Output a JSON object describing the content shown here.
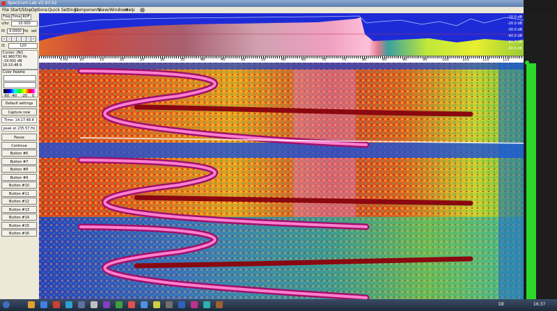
{
  "window": {
    "title": "Spectrum Lab V2.93 b2"
  },
  "menu": [
    "File",
    "Start/Stop",
    "Options",
    "Quick Settings",
    "Components",
    "View/Windows",
    "Help"
  ],
  "tabs": [
    "Freq",
    "Time",
    "RDF"
  ],
  "controls": {
    "vertical_label": "v/hz",
    "freq_value": "10 000",
    "offset_label": "f0",
    "offset_value": "0.0000",
    "offset_unit": "Hz",
    "offset_button": "set",
    "zoom_label": "f2",
    "zoom_value": "120"
  },
  "cursor": {
    "header": "Cursor: [Ni]",
    "freq": "42.960730 Hz",
    "level": "-19.001 dB",
    "time": "16:10:48.9"
  },
  "palette": {
    "header": "Color Palette",
    "scale": [
      "-60",
      "-40",
      "-20",
      "0"
    ]
  },
  "buttons": {
    "default_settings": "Default settings",
    "capture_now": "Capture now",
    "pause": "Pause",
    "continue": "Continue",
    "custom": [
      "Button #6",
      "Button #7",
      "Button #8",
      "Button #9",
      "Button #10",
      "Button #11",
      "Button #12",
      "Button #13",
      "Button #14",
      "Button #15",
      "Button #16"
    ]
  },
  "status": {
    "time": "Time: 14:17:48.4",
    "peak": "peak at 235.57 Hz"
  },
  "db_scale": [
    "-10.0 dB",
    "-20.0 dB",
    "-30.0 dB",
    "-40.0 dB",
    "-50.0 dB",
    "-60.0 dB"
  ],
  "freq_axis": [
    "5  Hz",
    "10",
    "15",
    "20",
    "25",
    "30",
    "35",
    "40",
    "45",
    "50",
    "55",
    "60",
    "65",
    "70",
    "75",
    "80",
    "85",
    "90",
    "95",
    "100",
    "105",
    "110",
    "115"
  ],
  "taskbar": {
    "lang": "DE",
    "clock": "16:37"
  },
  "colors": {
    "waterfall_bg": "#1a3fd0",
    "spectrum_bg": "#1d2bd6",
    "level_bar": "#22dd22"
  }
}
